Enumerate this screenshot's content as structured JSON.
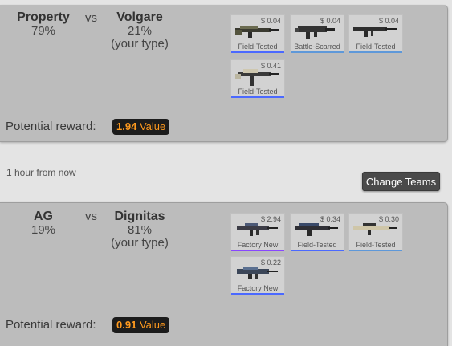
{
  "matches": [
    {
      "team_a": {
        "name": "Property",
        "percent": "79%"
      },
      "vs": "vs",
      "team_b": {
        "name": "Volgare",
        "percent": "21%",
        "note": "(your type)"
      },
      "items": [
        {
          "price": "$ 0.04",
          "condition": "Field-Tested"
        },
        {
          "price": "$ 0.04",
          "condition": "Battle-Scarred"
        },
        {
          "price": "$ 0.04",
          "condition": "Field-Tested"
        },
        {
          "price": "$ 0.41",
          "condition": "Field-Tested"
        }
      ],
      "reward_label": "Potential reward:",
      "reward_value": "1.94",
      "reward_unit": "Value"
    },
    {
      "team_a": {
        "name": "AG",
        "percent": "19%"
      },
      "vs": "vs",
      "team_b": {
        "name": "Dignitas",
        "percent": "81%",
        "note": "(your type)"
      },
      "items": [
        {
          "price": "$ 2.94",
          "condition": "Factory New"
        },
        {
          "price": "$ 0.34",
          "condition": "Field-Tested"
        },
        {
          "price": "$ 0.30",
          "condition": "Field-Tested"
        },
        {
          "price": "$ 0.22",
          "condition": "Factory New"
        }
      ],
      "reward_label": "Potential reward:",
      "reward_value": "0.91",
      "reward_unit": "Value"
    }
  ],
  "divider": {
    "time": "1 hour from now",
    "button": "Change Teams"
  },
  "colors": {
    "rarity_blue": "#4b69ff",
    "rarity_purple": "#8847ff",
    "rarity_lightblue": "#5e98d9",
    "reward_orange": "#ff9a1e"
  }
}
